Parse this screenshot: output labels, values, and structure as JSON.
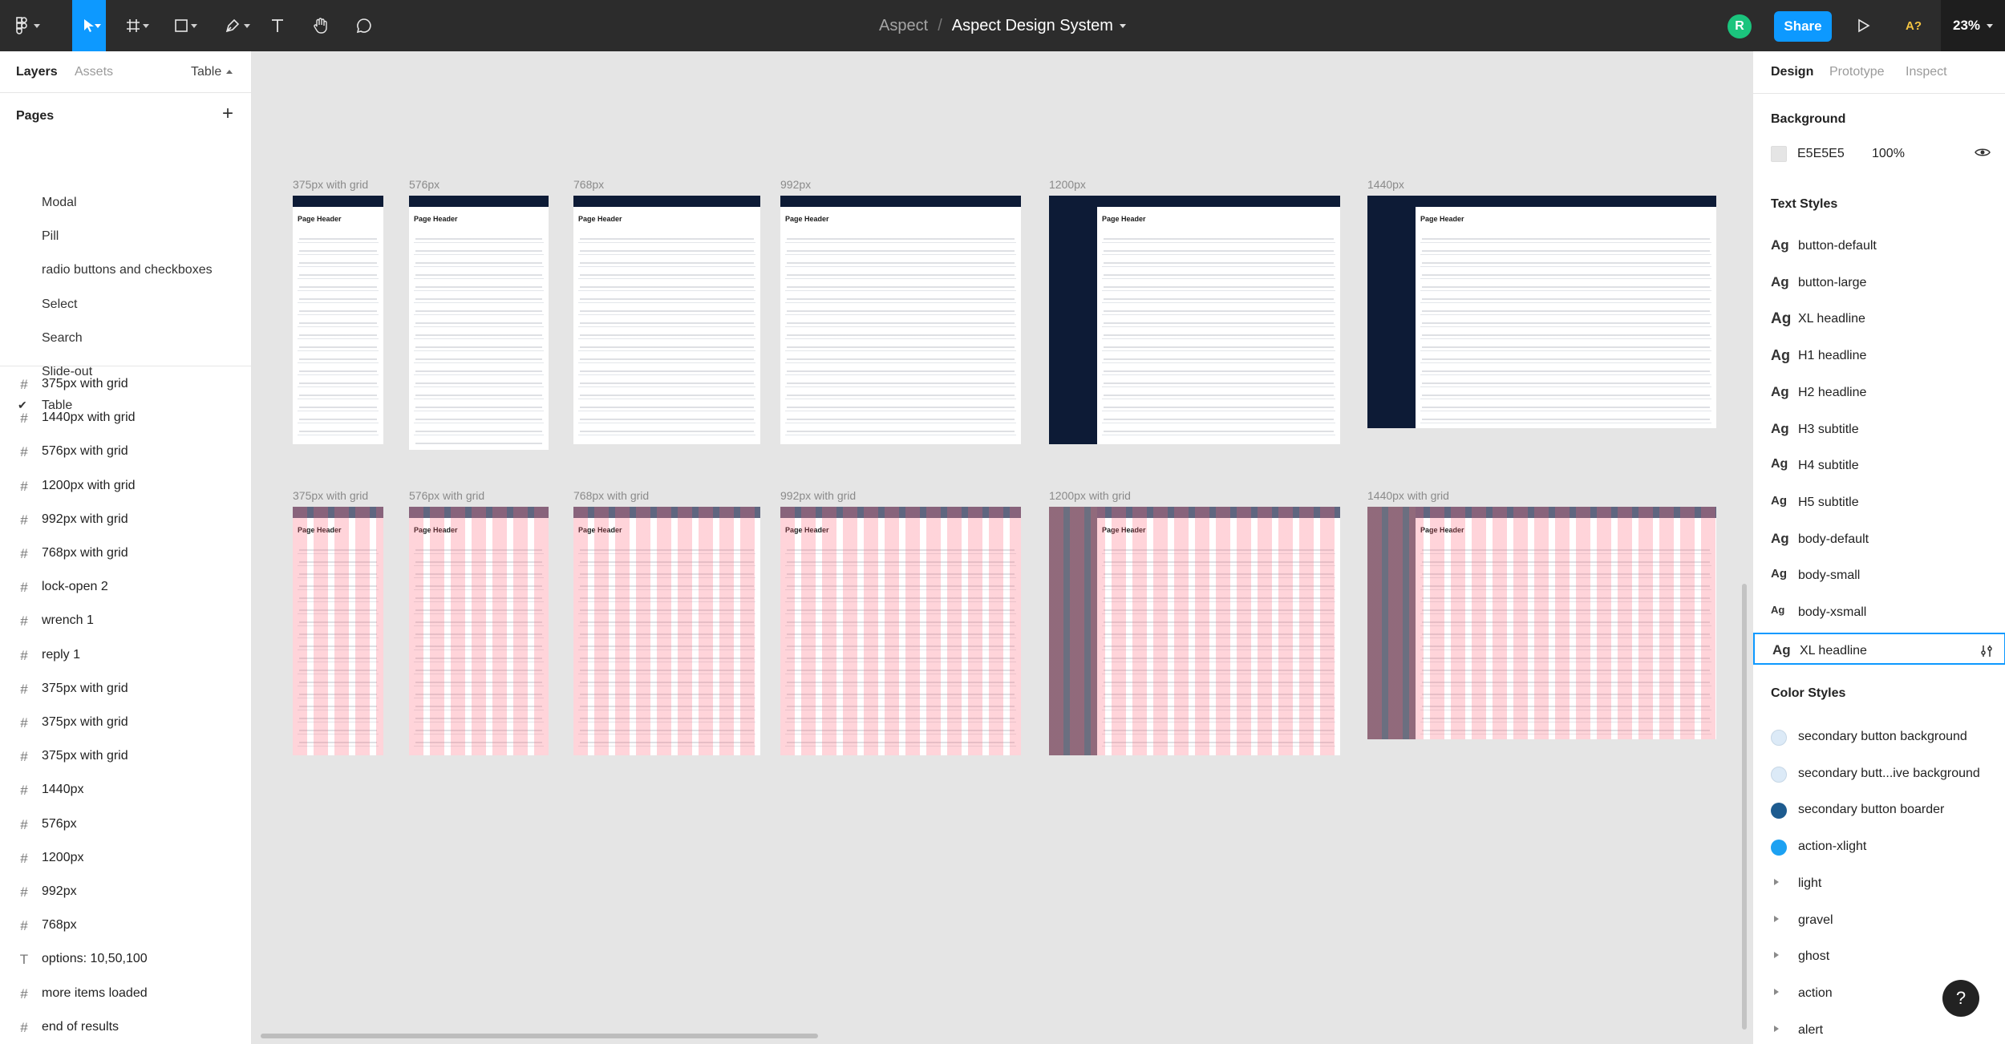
{
  "toolbar": {
    "project": "Aspect",
    "separator": "/",
    "file_name": "Aspect Design System",
    "avatar_initial": "R",
    "share_label": "Share",
    "a11y_label": "A?",
    "zoom": "23%"
  },
  "left_panel": {
    "tabs": {
      "layers": "Layers",
      "assets": "Assets"
    },
    "current_page": "Table",
    "pages_heading": "Pages",
    "add_icon": "+",
    "pages": [
      {
        "label": "Modal"
      },
      {
        "label": "Pill"
      },
      {
        "label": "radio buttons and checkboxes"
      },
      {
        "label": "Select"
      },
      {
        "label": "Search"
      },
      {
        "label": "Slide-out"
      },
      {
        "label": "Table",
        "selected": true
      }
    ],
    "layers": [
      {
        "label": "375px with grid",
        "icon": "frame-icon"
      },
      {
        "label": "1440px with grid",
        "icon": "frame-icon"
      },
      {
        "label": "576px with grid",
        "icon": "frame-icon"
      },
      {
        "label": "1200px with grid",
        "icon": "frame-icon"
      },
      {
        "label": "992px with grid",
        "icon": "frame-icon"
      },
      {
        "label": "768px with grid",
        "icon": "frame-icon"
      },
      {
        "label": "lock-open 2",
        "icon": "frame-icon"
      },
      {
        "label": "wrench 1",
        "icon": "frame-icon"
      },
      {
        "label": "reply 1",
        "icon": "frame-icon"
      },
      {
        "label": "375px with grid",
        "icon": "frame-icon"
      },
      {
        "label": "375px with grid",
        "icon": "frame-icon"
      },
      {
        "label": "375px with grid",
        "icon": "frame-icon"
      },
      {
        "label": "1440px",
        "icon": "frame-icon"
      },
      {
        "label": "576px",
        "icon": "frame-icon"
      },
      {
        "label": "1200px",
        "icon": "frame-icon"
      },
      {
        "label": "992px",
        "icon": "frame-icon"
      },
      {
        "label": "768px",
        "icon": "frame-icon"
      },
      {
        "label": "options: 10,50,100",
        "icon": "text-icon"
      },
      {
        "label": "more items loaded",
        "icon": "frame-icon"
      },
      {
        "label": "end of results",
        "icon": "frame-icon"
      }
    ]
  },
  "canvas": {
    "frames": [
      {
        "label": "375px with grid",
        "title": "Page Header",
        "grid": false,
        "sidebar": false
      },
      {
        "label": "576px",
        "title": "Page Header",
        "grid": false,
        "sidebar": false
      },
      {
        "label": "768px",
        "title": "Page Header",
        "grid": false,
        "sidebar": false
      },
      {
        "label": "992px",
        "title": "Page Header",
        "grid": false,
        "sidebar": false
      },
      {
        "label": "1200px",
        "title": "Page Header",
        "grid": false,
        "sidebar": true
      },
      {
        "label": "1440px",
        "title": "Page Header",
        "grid": false,
        "sidebar": true
      },
      {
        "label": "375px with grid",
        "title": "Page Header",
        "grid": true,
        "sidebar": false
      },
      {
        "label": "576px with grid",
        "title": "Page Header",
        "grid": true,
        "sidebar": false
      },
      {
        "label": "768px with grid",
        "title": "Page Header",
        "grid": true,
        "sidebar": false
      },
      {
        "label": "992px with grid",
        "title": "Page Header",
        "grid": true,
        "sidebar": false
      },
      {
        "label": "1200px with grid",
        "title": "Page Header",
        "grid": true,
        "sidebar": true
      },
      {
        "label": "1440px with grid",
        "title": "Page Header",
        "grid": true,
        "sidebar": true
      }
    ]
  },
  "right_panel": {
    "tabs": {
      "design": "Design",
      "prototype": "Prototype",
      "inspect": "Inspect"
    },
    "background": {
      "heading": "Background",
      "hex": "E5E5E5",
      "opacity": "100%",
      "color": "#E5E5E5"
    },
    "text_styles_heading": "Text Styles",
    "text_styles": [
      {
        "label": "button-default",
        "ag": "Ag"
      },
      {
        "label": "button-large",
        "ag": "Ag"
      },
      {
        "label": "XL headline",
        "ag": "Ag"
      },
      {
        "label": "H1 headline",
        "ag": "Ag"
      },
      {
        "label": "H2 headline",
        "ag": "Ag"
      },
      {
        "label": "H3 subtitle",
        "ag": "Ag"
      },
      {
        "label": "H4 subtitle",
        "ag": "Ag"
      },
      {
        "label": "H5 subtitle",
        "ag": "Ag"
      },
      {
        "label": "body-default",
        "ag": "Ag"
      },
      {
        "label": "body-small",
        "ag": "Ag"
      },
      {
        "label": "body-xsmall",
        "ag": "Ag"
      },
      {
        "label": "XL headline",
        "ag": "Ag",
        "selected": true
      }
    ],
    "color_styles_heading": "Color Styles",
    "color_styles": [
      {
        "label": "secondary button background",
        "color": "#DCEAF7"
      },
      {
        "label": "secondary butt...ive background",
        "color": "#DCEAF7"
      },
      {
        "label": "secondary button boarder",
        "color": "#1D5B8F"
      },
      {
        "label": "action-xlight",
        "color": "#1CA1F2"
      }
    ],
    "color_groups": [
      "light",
      "gravel",
      "ghost",
      "action",
      "alert"
    ]
  },
  "help_label": "?"
}
